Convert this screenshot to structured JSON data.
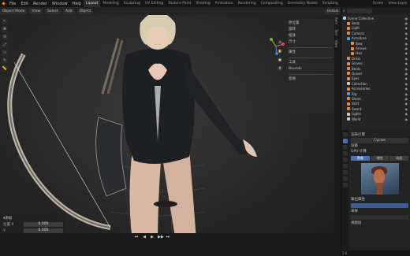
{
  "app": {
    "logo_glyph": "◆",
    "menus": [
      "File",
      "Edit",
      "Render",
      "Window",
      "Help"
    ],
    "workspace_tabs": [
      {
        "label": "Layout",
        "active": true
      },
      {
        "label": "Modeling",
        "active": false
      },
      {
        "label": "Sculpting",
        "active": false
      },
      {
        "label": "UV Editing",
        "active": false
      },
      {
        "label": "Texture Paint",
        "active": false
      },
      {
        "label": "Shading",
        "active": false
      },
      {
        "label": "Animation",
        "active": false
      },
      {
        "label": "Rendering",
        "active": false
      },
      {
        "label": "Compositing",
        "active": false
      },
      {
        "label": "Geometry Nodes",
        "active": false
      },
      {
        "label": "Scripting",
        "active": false
      }
    ],
    "scene_label": "Scene",
    "view_layer_label": "View Layer"
  },
  "viewport_header": {
    "mode": "Object Mode",
    "buttons": [
      "View",
      "Select",
      "Add",
      "Object"
    ],
    "transform": "Global"
  },
  "viewport_tools": [
    "↖",
    "✥",
    "⟲",
    "⤢",
    "▭",
    "✎",
    "📏"
  ],
  "n_panel": {
    "rows": [
      "原位置",
      "旋转",
      "缩放",
      "尺寸",
      "",
      "属性",
      "",
      "工具",
      "Bounds",
      "",
      "变换"
    ]
  },
  "op_panel": {
    "title": "添加",
    "rows": [
      {
        "label": "位置 X",
        "value": "0.000"
      },
      {
        "label": "Y",
        "value": "0.000"
      },
      {
        "label": "Z",
        "value": "0.000"
      }
    ],
    "checkbox_label": "对齐"
  },
  "timeline": {
    "controls": [
      "⏮",
      "◀",
      "▶",
      "▶▶",
      "⏭"
    ]
  },
  "outliner": {
    "search_placeholder": "",
    "items": [
      {
        "label": "Scene Collection",
        "indent": 0,
        "color": "#cccccc",
        "selected": false
      },
      {
        "label": "Body",
        "indent": 1,
        "color": "#e0904a",
        "selected": false
      },
      {
        "label": "Light",
        "indent": 1,
        "color": "#e0904a",
        "selected": false
      },
      {
        "label": "Camera",
        "indent": 1,
        "color": "#e0904a",
        "selected": false
      },
      {
        "label": "Armature",
        "indent": 1,
        "color": "#4aa0e0",
        "selected": false
      },
      {
        "label": "Bow",
        "indent": 2,
        "color": "#e0904a",
        "selected": false
      },
      {
        "label": "Arrows",
        "indent": 2,
        "color": "#e0904a",
        "selected": false
      },
      {
        "label": "Hair",
        "indent": 2,
        "color": "#e0904a",
        "selected": false
      },
      {
        "label": "Dress",
        "indent": 1,
        "color": "#e0904a",
        "selected": false
      },
      {
        "label": "Gloves",
        "indent": 1,
        "color": "#e0904a",
        "selected": false
      },
      {
        "label": "Boots",
        "indent": 1,
        "color": "#e0904a",
        "selected": false
      },
      {
        "label": "Quiver",
        "indent": 1,
        "color": "#e0904a",
        "selected": false
      },
      {
        "label": "Eyes",
        "indent": 1,
        "color": "#e0904a",
        "selected": false
      },
      {
        "label": "Collection",
        "indent": 1,
        "color": "#cccccc",
        "selected": false
      },
      {
        "label": "Accessories",
        "indent": 1,
        "color": "#e0904a",
        "selected": false
      },
      {
        "label": "Rig",
        "indent": 1,
        "color": "#4aa0e0",
        "selected": false
      },
      {
        "label": "Shoes",
        "indent": 1,
        "color": "#e0904a",
        "selected": false
      },
      {
        "label": "Skirt",
        "indent": 1,
        "color": "#e0904a",
        "selected": false
      },
      {
        "label": "Sword",
        "indent": 1,
        "color": "#e0904a",
        "selected": false
      },
      {
        "label": "Lights",
        "indent": 1,
        "color": "#cccccc",
        "selected": false
      },
      {
        "label": "World",
        "indent": 1,
        "color": "#cccccc",
        "selected": false
      }
    ]
  },
  "properties": {
    "rows": [
      "渲染引擎",
      "Cycles",
      "设备",
      "GPU 计算"
    ],
    "engine": "Cycles",
    "buttons": [
      {
        "label": "图像",
        "active": true
      },
      {
        "label": "视频",
        "active": false
      },
      {
        "label": "动画",
        "active": false
      }
    ],
    "lower_rows": [
      "输出属性",
      "采样",
      "视图层"
    ],
    "accent_color": "#4772b3"
  },
  "status_text": "3.6"
}
